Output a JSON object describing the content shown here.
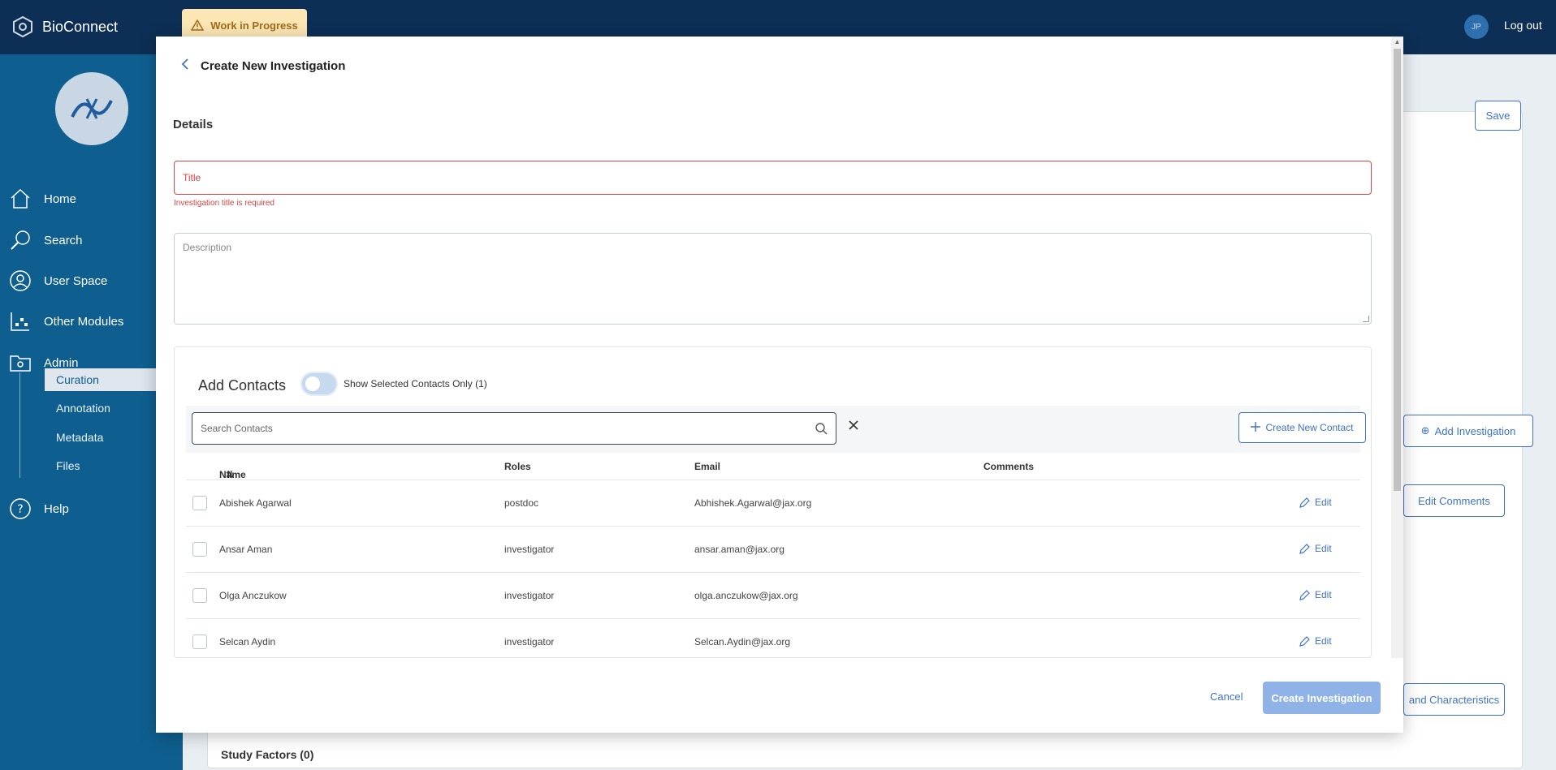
{
  "app": {
    "name": "BioConnect",
    "status_badge": "Work in Progress",
    "user_initials": "JP",
    "logout": "Log out"
  },
  "sidebar": {
    "items": [
      {
        "label": "Home",
        "icon": "home-icon"
      },
      {
        "label": "Search",
        "icon": "search-icon"
      },
      {
        "label": "User Space",
        "icon": "user-icon"
      },
      {
        "label": "Other Modules",
        "icon": "modules-icon"
      },
      {
        "label": "Admin",
        "icon": "admin-folder-icon"
      },
      {
        "label": "Help",
        "icon": "help-icon"
      }
    ],
    "subitems": [
      {
        "label": "Curation",
        "active": true
      },
      {
        "label": "Annotation",
        "active": false
      },
      {
        "label": "Metadata",
        "active": false
      },
      {
        "label": "Files",
        "active": false
      }
    ]
  },
  "background": {
    "save": "Save",
    "add_investigation": "Add Investigation",
    "edit_comments": "Edit Comments",
    "characteristics": "and Characteristics",
    "study_factors": "Study Factors (0)"
  },
  "modal": {
    "title": "Create New Investigation",
    "section": "Details",
    "title_placeholder": "Title",
    "title_error": "Investigation title is required",
    "description_placeholder": "Description",
    "contacts": {
      "heading": "Add Contacts",
      "toggle_label": "Show Selected Contacts Only (1)",
      "search_placeholder": "Search Contacts",
      "new_contact": "Create New Contact",
      "columns": {
        "name": "Name",
        "roles": "Roles",
        "email": "Email",
        "comments": "Comments"
      },
      "edit_label": "Edit",
      "rows": [
        {
          "name": "Abishek Agarwal",
          "role": "postdoc",
          "email": "Abhishek.Agarwal@jax.org",
          "comments": ""
        },
        {
          "name": "Ansar Aman",
          "role": "investigator",
          "email": "ansar.aman@jax.org",
          "comments": ""
        },
        {
          "name": "Olga Anczukow",
          "role": "investigator",
          "email": "olga.anczukow@jax.org",
          "comments": ""
        },
        {
          "name": "Selcan Aydin",
          "role": "investigator",
          "email": "Selcan.Aydin@jax.org",
          "comments": ""
        }
      ]
    },
    "cancel": "Cancel",
    "create": "Create Investigation"
  },
  "colors": {
    "topbar": "#0d2f55",
    "sidebar": "#0e5f8f",
    "accent": "#3f72c8",
    "error": "#d64545"
  }
}
